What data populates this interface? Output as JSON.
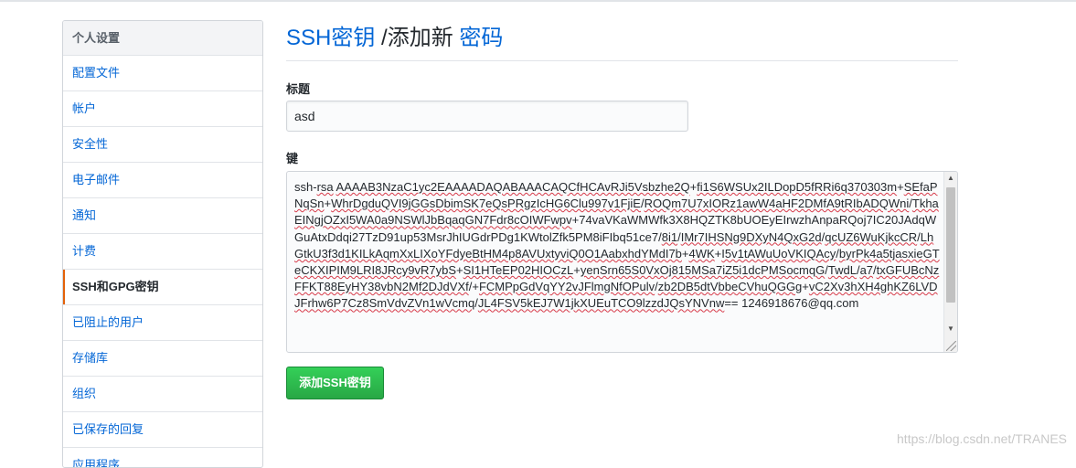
{
  "sidebar": {
    "header": "个人设置",
    "items": [
      {
        "label": "配置文件",
        "name": "sidebar-item-profile"
      },
      {
        "label": "帐户",
        "name": "sidebar-item-account"
      },
      {
        "label": "安全性",
        "name": "sidebar-item-security"
      },
      {
        "label": "电子邮件",
        "name": "sidebar-item-emails"
      },
      {
        "label": "通知",
        "name": "sidebar-item-notifications"
      },
      {
        "label": "计费",
        "name": "sidebar-item-billing"
      },
      {
        "label": "SSH和GPG密钥",
        "name": "sidebar-item-ssh-gpg-keys",
        "selected": true
      },
      {
        "label": "已阻止的用户",
        "name": "sidebar-item-blocked-users"
      },
      {
        "label": "存储库",
        "name": "sidebar-item-repositories"
      },
      {
        "label": "组织",
        "name": "sidebar-item-organizations"
      },
      {
        "label": "已保存的回复",
        "name": "sidebar-item-saved-replies"
      },
      {
        "label": "应用程序",
        "name": "sidebar-item-applications"
      }
    ]
  },
  "page": {
    "title_link1": "SSH密钥",
    "title_sep": " /添加新 ",
    "title_link2": "密码"
  },
  "form": {
    "title_label": "标题",
    "title_value": "asd",
    "key_label": "键",
    "key_segments": [
      {
        "t": "ssh-",
        "u": false
      },
      {
        "t": "rsa",
        "u": true
      },
      {
        "t": " ",
        "u": false
      },
      {
        "t": "AAAAB3NzaC1yc2EAAAADAQABAAACAQCfHCAvRJi5Vsbzhe2Q",
        "u": true
      },
      {
        "t": "+",
        "u": false
      },
      {
        "t": "fi1S6WSUx2ILDopD5fRRi6q370303m",
        "u": true
      },
      {
        "t": "+",
        "u": false
      },
      {
        "t": "SEfaPNqSn",
        "u": true
      },
      {
        "t": "+",
        "u": false
      },
      {
        "t": "WhrDgduQVI9jGGsDbimSK7eQsPRgzIcHG6Clu997v1FjiE",
        "u": true
      },
      {
        "t": "/",
        "u": false
      },
      {
        "t": "ROQm7U7xIORz1awW4aHF2DMfA9tRIbADQWni",
        "u": true
      },
      {
        "t": "/",
        "u": false
      },
      {
        "t": "TkhaEINgjOZxI5WA0a9NSWlJbBqaqGN7Fdr8cOIWFwpv",
        "u": true
      },
      {
        "t": "+74vaVKaWMWfk3X8HQZTK8bUOEyEIrwzhAnpaRQoj7IC20JAdqWGuAtxDdqi27TzD91up53MsrJhIUGdrPDg1KWtolZfk5PM8iFIbq51ce7/",
        "u": false
      },
      {
        "t": "8i1",
        "u": true
      },
      {
        "t": "/",
        "u": false
      },
      {
        "t": "IMr7IHSNg9DXyN4QxG2d",
        "u": true
      },
      {
        "t": "/",
        "u": false
      },
      {
        "t": "qcUZ6WuKjkcCR",
        "u": true
      },
      {
        "t": "/",
        "u": false
      },
      {
        "t": "LhGtkU3f3d1KILkAqmXxLIXoYFdyeBtHM4p8AVUxtyviQ0O1AabxhdYMdI7b",
        "u": true
      },
      {
        "t": "+",
        "u": false
      },
      {
        "t": "4WK",
        "u": true
      },
      {
        "t": "+",
        "u": false
      },
      {
        "t": "I5v1tAWuUoVKIQAcy",
        "u": true
      },
      {
        "t": "/",
        "u": false
      },
      {
        "t": "byrPk4a5tjasxieGTeCKXIPIM9LRI8JRcy9vR7ybS",
        "u": true
      },
      {
        "t": "+",
        "u": false
      },
      {
        "t": "SI1HTeEP02HIOCzL",
        "u": true
      },
      {
        "t": "+",
        "u": false
      },
      {
        "t": "yenSrn65S0VxOj815MSa7iZ5i1dcPMSocmqG",
        "u": true
      },
      {
        "t": "/",
        "u": false
      },
      {
        "t": "TwdL",
        "u": true
      },
      {
        "t": "/",
        "u": false
      },
      {
        "t": "a7",
        "u": true
      },
      {
        "t": "/",
        "u": false
      },
      {
        "t": "txGFUBcNzFFKT88EyHY38vbN2Mf2DJdVXf",
        "u": true
      },
      {
        "t": "/+",
        "u": false
      },
      {
        "t": "FCMPpGdVqYY2vJFlmgNfOPulv",
        "u": true
      },
      {
        "t": "/",
        "u": false
      },
      {
        "t": "zb2DB5dtVbbeCVhuQGGg",
        "u": true
      },
      {
        "t": "+",
        "u": false
      },
      {
        "t": "vC2Xv3hXH4ghKZ6LVDJFrhw6P7Cz8SmVdvZVn1wVcmq",
        "u": true
      },
      {
        "t": "/",
        "u": false
      },
      {
        "t": "JL4FSV5kEJ7W1jkXUEuTCO9lzzdJQsYNVnw",
        "u": true
      },
      {
        "t": "== 1246918676@qq.com",
        "u": false
      }
    ],
    "submit_label": "添加SSH密钥"
  },
  "watermark": "https://blog.csdn.net/TRANES"
}
